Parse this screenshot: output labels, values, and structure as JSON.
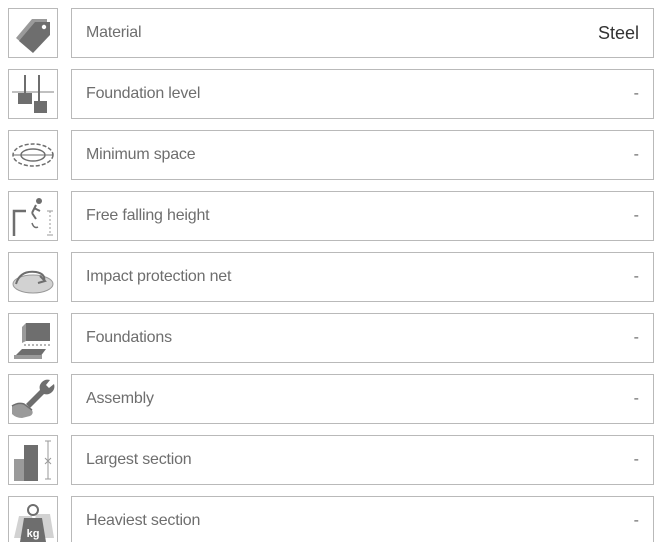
{
  "specs": [
    {
      "label": "Material",
      "value": "Steel",
      "icon": "price-tag-icon"
    },
    {
      "label": "Foundation level",
      "value": "-",
      "icon": "foundation-level-icon"
    },
    {
      "label": "Minimum space",
      "value": "-",
      "icon": "minimum-space-icon"
    },
    {
      "label": "Free falling height",
      "value": "-",
      "icon": "free-fall-height-icon"
    },
    {
      "label": "Impact protection net",
      "value": "-",
      "icon": "impact-protection-icon"
    },
    {
      "label": "Foundations",
      "value": "-",
      "icon": "foundations-icon"
    },
    {
      "label": "Assembly",
      "value": "-",
      "icon": "wrench-hand-icon"
    },
    {
      "label": "Largest section",
      "value": "-",
      "icon": "largest-section-icon"
    },
    {
      "label": "Heaviest section",
      "value": "-",
      "icon": "weight-kg-icon"
    }
  ],
  "icon_text": {
    "weight_unit": "kg"
  },
  "colors": {
    "icon_dark": "#6e6e6e",
    "icon_mid": "#9a9a9a",
    "border": "#b9b9b9",
    "text": "#6e6e6e"
  }
}
